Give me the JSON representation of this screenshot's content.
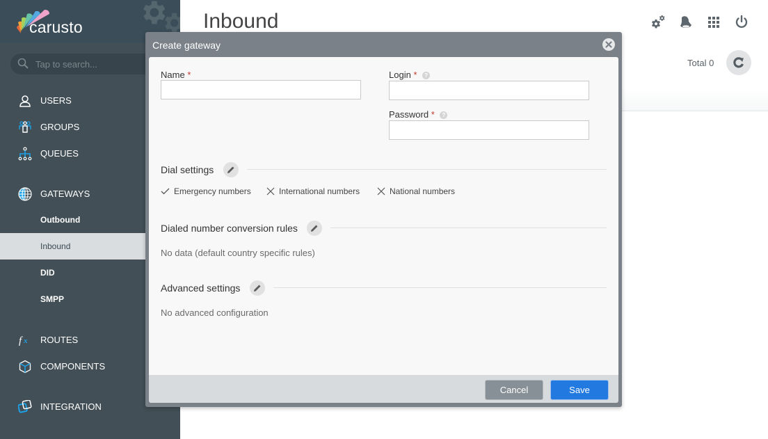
{
  "app": {
    "brand": "carusto",
    "search_placeholder": "Tap to search..."
  },
  "sidebar": {
    "items": [
      {
        "label": "USERS",
        "icon": "user-icon"
      },
      {
        "label": "GROUPS",
        "icon": "groups-icon"
      },
      {
        "label": "QUEUES",
        "icon": "queues-icon"
      },
      {
        "label": "GATEWAYS",
        "icon": "globe-icon"
      },
      {
        "label": "ROUTES",
        "icon": "fx-icon"
      },
      {
        "label": "COMPONENTS",
        "icon": "cube-icon"
      },
      {
        "label": "INTEGRATION",
        "icon": "integration-icon"
      }
    ],
    "gateway_subitems": [
      {
        "label": "Outbound",
        "active": false
      },
      {
        "label": "Inbound",
        "active": true
      },
      {
        "label": "DID",
        "active": false
      },
      {
        "label": "SMPP",
        "active": false
      }
    ]
  },
  "header": {
    "title": "Inbound",
    "icons": [
      "settings-gears-icon",
      "bell-icon",
      "apps-grid-icon",
      "power-icon"
    ],
    "total_label": "Total 0"
  },
  "modal": {
    "title": "Create gateway",
    "fields": {
      "name": {
        "label": "Name",
        "required": "*",
        "value": "",
        "placeholder": ""
      },
      "login": {
        "label": "Login",
        "required": "*",
        "value": "",
        "placeholder": ""
      },
      "password": {
        "label": "Password",
        "required": "*",
        "value": "",
        "placeholder": ""
      }
    },
    "dial_settings": {
      "title": "Dial settings",
      "options": [
        {
          "label": "Emergency numbers",
          "enabled": true
        },
        {
          "label": "International numbers",
          "enabled": false
        },
        {
          "label": "National numbers",
          "enabled": false
        }
      ]
    },
    "conversion_rules": {
      "title": "Dialed number conversion rules",
      "empty_text": "No data (default country specific rules)"
    },
    "advanced_settings": {
      "title": "Advanced settings",
      "empty_text": "No advanced configuration"
    },
    "buttons": {
      "cancel": "Cancel",
      "save": "Save"
    }
  },
  "colors": {
    "sidebar_bg": "#424f56",
    "accent_blue": "#2279e0",
    "icon_blue": "#1da1e6",
    "modal_header": "#7a8188"
  }
}
